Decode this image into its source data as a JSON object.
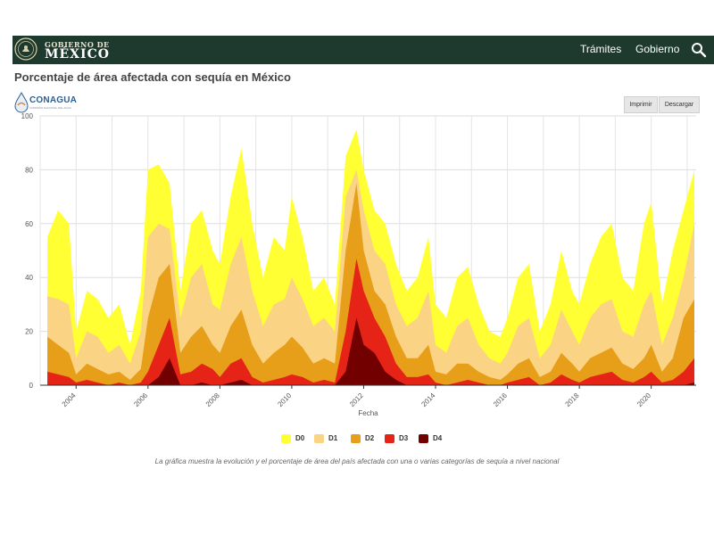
{
  "header": {
    "logo_small": "GOBIERNO DE",
    "logo_big": "MÉXICO",
    "nav": [
      "Trámites",
      "Gobierno"
    ],
    "search_icon": "search-icon",
    "bar_color": "#1e3a2e"
  },
  "page": {
    "title": "Porcentaje de área afectada con sequía en México",
    "caption": "La gráfica muestra la evolución y el porcentaje de área del país afectada con una o varias categorías de sequía a nivel nacional"
  },
  "conagua": {
    "name": "CONAGUA",
    "subtitle": "COMISIÓN NACIONAL DEL AGUA"
  },
  "toolbar": {
    "print_label": "Imprimir",
    "download_label": "Descargar"
  },
  "chart_data": {
    "type": "area",
    "xlabel": "Fecha",
    "ylabel": "",
    "ylim": [
      0,
      100
    ],
    "xlim": [
      2003.0,
      2021.25
    ],
    "yticks": [
      0,
      20,
      40,
      60,
      80,
      100
    ],
    "xticks": [
      2004,
      2006,
      2008,
      2010,
      2012,
      2014,
      2016,
      2018,
      2020
    ],
    "grid": true,
    "legend_position": "bottom",
    "x": [
      2003.2,
      2003.5,
      2003.8,
      2004.0,
      2004.3,
      2004.6,
      2004.9,
      2005.2,
      2005.5,
      2005.8,
      2006.0,
      2006.3,
      2006.6,
      2006.9,
      2007.2,
      2007.5,
      2007.8,
      2008.0,
      2008.3,
      2008.6,
      2008.9,
      2009.2,
      2009.5,
      2009.8,
      2010.0,
      2010.3,
      2010.6,
      2010.9,
      2011.2,
      2011.5,
      2011.8,
      2012.0,
      2012.3,
      2012.6,
      2012.9,
      2013.2,
      2013.5,
      2013.8,
      2014.0,
      2014.3,
      2014.6,
      2014.9,
      2015.2,
      2015.5,
      2015.8,
      2016.0,
      2016.3,
      2016.6,
      2016.9,
      2017.2,
      2017.5,
      2017.8,
      2018.0,
      2018.3,
      2018.6,
      2018.9,
      2019.2,
      2019.5,
      2019.8,
      2020.0,
      2020.3,
      2020.6,
      2020.9,
      2021.2
    ],
    "series": [
      {
        "name": "D0",
        "color": "#ffff33",
        "values": [
          55,
          65,
          60,
          20,
          35,
          32,
          25,
          30,
          15,
          35,
          80,
          82,
          75,
          35,
          60,
          65,
          50,
          45,
          70,
          88,
          60,
          40,
          55,
          50,
          70,
          55,
          35,
          40,
          30,
          85,
          95,
          80,
          65,
          60,
          45,
          35,
          40,
          55,
          30,
          25,
          40,
          44,
          30,
          20,
          18,
          25,
          40,
          45,
          20,
          30,
          50,
          35,
          30,
          45,
          55,
          60,
          40,
          35,
          60,
          68,
          30,
          50,
          65,
          80
        ]
      },
      {
        "name": "D1",
        "color": "#fbd385",
        "values": [
          33,
          32,
          30,
          10,
          20,
          18,
          12,
          15,
          8,
          20,
          55,
          60,
          58,
          25,
          40,
          45,
          30,
          28,
          45,
          55,
          35,
          22,
          30,
          32,
          40,
          32,
          22,
          25,
          20,
          70,
          80,
          65,
          50,
          45,
          30,
          22,
          25,
          35,
          15,
          12,
          22,
          25,
          15,
          10,
          8,
          12,
          22,
          25,
          10,
          15,
          28,
          20,
          15,
          25,
          30,
          32,
          20,
          18,
          30,
          35,
          15,
          25,
          40,
          60
        ]
      },
      {
        "name": "D2",
        "color": "#e79e18",
        "values": [
          18,
          15,
          12,
          4,
          8,
          6,
          4,
          5,
          2,
          6,
          25,
          40,
          45,
          12,
          18,
          22,
          15,
          12,
          22,
          28,
          15,
          8,
          12,
          15,
          18,
          14,
          8,
          10,
          8,
          50,
          75,
          50,
          35,
          30,
          18,
          10,
          10,
          15,
          5,
          4,
          8,
          8,
          5,
          3,
          2,
          4,
          8,
          10,
          3,
          5,
          12,
          8,
          5,
          10,
          12,
          14,
          8,
          6,
          10,
          15,
          5,
          10,
          25,
          32
        ]
      },
      {
        "name": "D3",
        "color": "#e52316",
        "values": [
          5,
          4,
          3,
          1,
          2,
          1,
          0,
          1,
          0,
          1,
          5,
          15,
          25,
          4,
          5,
          8,
          6,
          3,
          8,
          10,
          3,
          1,
          2,
          3,
          4,
          3,
          1,
          2,
          1,
          20,
          47,
          35,
          25,
          18,
          8,
          3,
          3,
          4,
          1,
          0,
          1,
          2,
          1,
          0,
          0,
          1,
          2,
          3,
          0,
          1,
          4,
          2,
          1,
          3,
          4,
          5,
          2,
          1,
          3,
          5,
          1,
          2,
          5,
          10
        ]
      },
      {
        "name": "D4",
        "color": "#730000",
        "values": [
          0,
          0,
          0,
          0,
          0,
          0,
          0,
          0,
          0,
          0,
          0,
          3,
          10,
          0,
          0,
          1,
          0,
          0,
          1,
          2,
          0,
          0,
          0,
          0,
          0,
          0,
          0,
          0,
          0,
          5,
          25,
          15,
          12,
          5,
          2,
          0,
          0,
          0,
          0,
          0,
          0,
          0,
          0,
          0,
          0,
          0,
          0,
          0,
          0,
          0,
          0,
          0,
          0,
          0,
          0,
          0,
          0,
          0,
          0,
          0,
          0,
          0,
          0,
          1
        ]
      }
    ]
  }
}
